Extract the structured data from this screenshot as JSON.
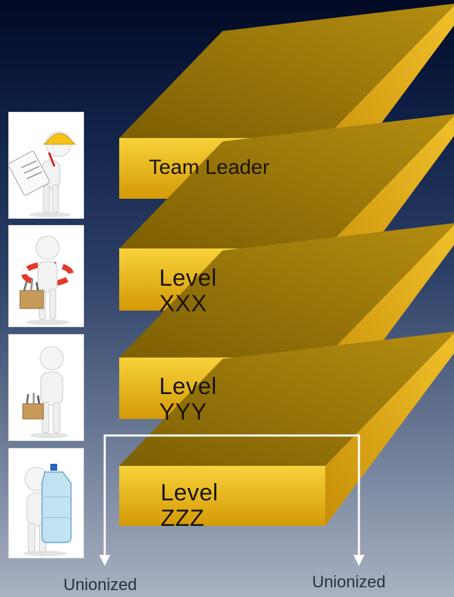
{
  "levels": [
    {
      "label": "Team Leader",
      "figure": "supervisor-with-clipboard-icon"
    },
    {
      "label": "Level\nXXX",
      "figure": "worker-with-lifebuoy-and-toolbox-icon"
    },
    {
      "label": "Level\nYYY",
      "figure": "worker-with-toolbox-icon"
    },
    {
      "label": "Level\nZZZ",
      "figure": "worker-carrying-water-jug-icon"
    }
  ],
  "footer": {
    "left_label": "Unionized",
    "right_label": "Unionized"
  },
  "colors": {
    "slab_front_top": "#f7d23a",
    "slab_front_bottom": "#d49a06",
    "slab_top_face": "#8e6f06",
    "slab_side_face": "#e0a90c",
    "bracket": "#ffffff"
  }
}
